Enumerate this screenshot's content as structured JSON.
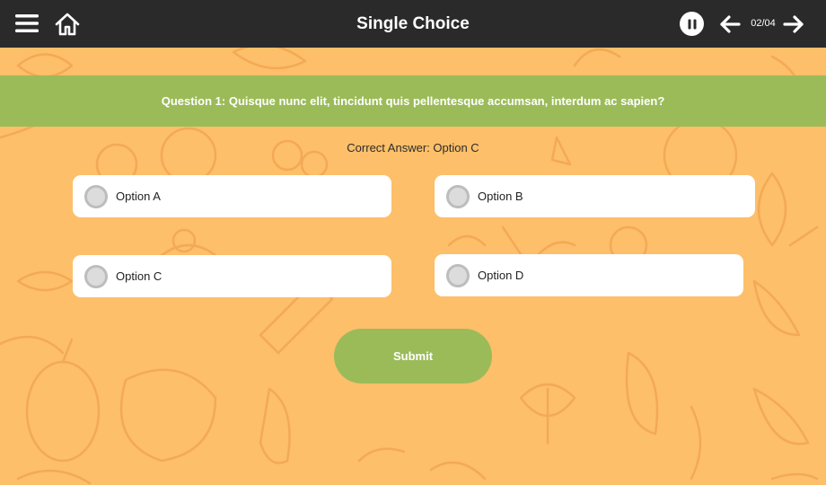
{
  "topbar": {
    "title": "Single Choice",
    "page_counter": "02/04",
    "icons": {
      "menu": "menu-icon",
      "home": "home-icon",
      "pause": "pause-icon",
      "prev": "arrow-left-icon",
      "next": "arrow-right-icon"
    }
  },
  "question": {
    "text": "Question 1: Quisque nunc elit, tincidunt quis pellentesque accumsan, interdum ac sapien?",
    "correct_answer": "Correct Answer: Option C"
  },
  "options": [
    {
      "label": "Option A",
      "selected": false
    },
    {
      "label": "Option B",
      "selected": false
    },
    {
      "label": "Option C",
      "selected": false
    },
    {
      "label": "Option D",
      "selected": false
    }
  ],
  "submit_label": "Submit",
  "colors": {
    "topbar": "#2a2a2a",
    "background": "#fdbf69",
    "pattern_stroke": "#f4a957",
    "accent_green": "#9bbb59",
    "card": "#ffffff"
  }
}
